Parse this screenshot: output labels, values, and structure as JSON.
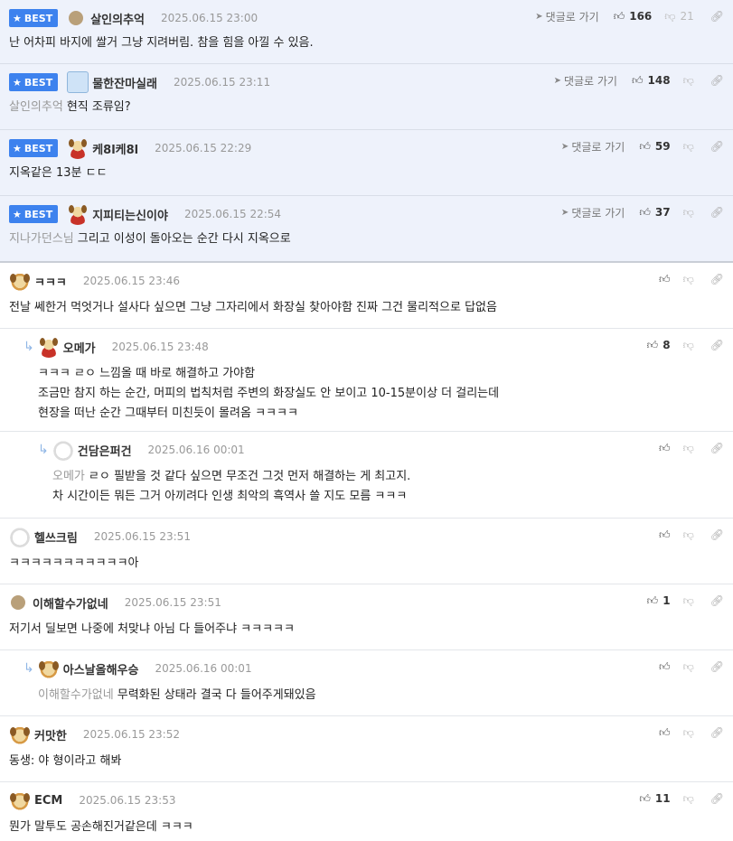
{
  "best_label": "BEST",
  "goto_label": "댓글로 가기",
  "comments": [
    {
      "best": true,
      "avatar": "circle",
      "name": "살인의추억",
      "date": "2025.06.15 23:00",
      "up": "166",
      "down": "21",
      "mention": "",
      "lines": [
        "난 어차피 바지에 쌀거 그냥 지려버림. 참을 힘을 아낄 수 있음."
      ]
    },
    {
      "best": true,
      "avatar": "bear",
      "name": "물한잔마실래",
      "date": "2025.06.15 23:11",
      "up": "148",
      "down": "",
      "mention": "살인의추억",
      "lines": [
        "현직 조류임?"
      ]
    },
    {
      "best": true,
      "avatar": "dog-red",
      "name": "케8l케8l",
      "date": "2025.06.15 22:29",
      "up": "59",
      "down": "",
      "mention": "",
      "lines": [
        "지옥같은 13분 ㄷㄷ"
      ]
    },
    {
      "best": true,
      "avatar": "dog-red",
      "name": "지피티는신이야",
      "date": "2025.06.15 22:54",
      "up": "37",
      "down": "",
      "mention": "지나가던스님",
      "lines": [
        "그리고 이성이 돌아오는 순간 다시 지옥으로"
      ]
    },
    {
      "best": false,
      "depth": 0,
      "avatar": "dog",
      "name": "ㅋㅋㅋ",
      "date": "2025.06.15 23:46",
      "up": "",
      "down": "",
      "mention": "",
      "lines": [
        "전날 쎄한거 먹엇거나 설사다 싶으면 그냥 그자리에서 화장실 찾아야함 진짜 그건 물리적으로 답없음"
      ]
    },
    {
      "best": false,
      "depth": 1,
      "avatar": "dog-red",
      "name": "오메가",
      "date": "2025.06.15 23:48",
      "up": "8",
      "down": "",
      "mention": "",
      "lines": [
        "ㅋㅋㅋ ㄹㅇ 느낌올 때 바로 해결하고 가야함",
        "조금만 참지 하는 순간, 머피의 법칙처럼 주변의 화장실도 안 보이고 10-15분이상 더 걸리는데",
        "현장을 떠난 순간 그때부터 미친듯이 몰려옴 ㅋㅋㅋㅋ"
      ]
    },
    {
      "best": false,
      "depth": 2,
      "avatar": "white",
      "name": "건담은퍼건",
      "date": "2025.06.16 00:01",
      "up": "",
      "down": "",
      "mention": "오메가",
      "lines": [
        "ㄹㅇ 필받을 것 같다 싶으면 무조건 그것 먼저 해결하는 게 최고지.",
        "차 시간이든 뭐든 그거 아끼려다 인생 최악의 흑역사 쓸 지도 모름 ㅋㅋㅋ"
      ]
    },
    {
      "best": false,
      "depth": 0,
      "avatar": "white",
      "name": "헬쓰크림",
      "date": "2025.06.15 23:51",
      "up": "",
      "down": "",
      "mention": "",
      "lines": [
        "ㅋㅋㅋㅋㅋㅋㅋㅋㅋㅋㅋ아"
      ]
    },
    {
      "best": false,
      "depth": 0,
      "avatar": "circle",
      "name": "이해할수가없네",
      "date": "2025.06.15 23:51",
      "up": "1",
      "down": "",
      "mention": "",
      "lines": [
        "저기서 딜보면 나중에 처맞냐 아님 다 들어주냐 ㅋㅋㅋㅋㅋ"
      ]
    },
    {
      "best": false,
      "depth": 1,
      "avatar": "dog",
      "name": "아스날올해우승",
      "date": "2025.06.16 00:01",
      "up": "",
      "down": "",
      "mention": "이해할수가없네",
      "lines": [
        "무력화된 상태라 결국 다 들어주게돼있음"
      ]
    },
    {
      "best": false,
      "depth": 0,
      "avatar": "dog",
      "name": "커맛한",
      "date": "2025.06.15 23:52",
      "up": "",
      "down": "",
      "mention": "",
      "lines": [
        "동생: 야 형이라고 해봐"
      ]
    },
    {
      "best": false,
      "depth": 0,
      "avatar": "dog",
      "name": "ECM",
      "date": "2025.06.15 23:53",
      "up": "11",
      "down": "",
      "mention": "",
      "lines": [
        "뭔가 말투도 공손해진거같은데 ㅋㅋㅋ"
      ]
    }
  ]
}
